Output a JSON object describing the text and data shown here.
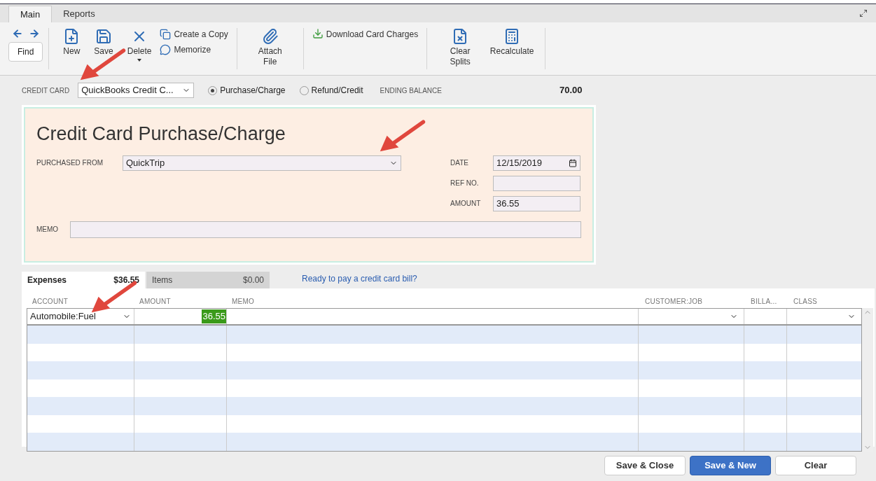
{
  "window_tabs": [
    {
      "label": "Main",
      "selected": true
    },
    {
      "label": "Reports",
      "selected": false
    }
  ],
  "toolbar": {
    "find": "Find",
    "groups": [
      [
        {
          "kind": "big",
          "label": "New"
        },
        {
          "kind": "big",
          "label": "Save"
        },
        {
          "kind": "dropdown",
          "label": "Delete"
        },
        {
          "kind": "stack",
          "items": [
            {
              "label": "Create a Copy"
            },
            {
              "label": "Memorize"
            }
          ]
        }
      ],
      [
        {
          "kind": "big",
          "label": "Attach File"
        }
      ],
      [
        {
          "kind": "inline",
          "label": "Download Card Charges"
        }
      ],
      [
        {
          "kind": "big",
          "label": "Clear Splits"
        },
        {
          "kind": "big",
          "label": "Recalculate"
        }
      ]
    ]
  },
  "account_bar": {
    "label": "CREDIT CARD",
    "account": "QuickBooks Credit C...",
    "modes": [
      {
        "label": "Purchase/Charge",
        "selected": true
      },
      {
        "label": "Refund/Credit",
        "selected": false
      }
    ],
    "balance_label": "ENDING BALANCE",
    "balance": "70.00"
  },
  "form": {
    "title": "Credit Card Purchase/Charge",
    "purchased_from_label": "PURCHASED FROM",
    "purchased_from": "QuickTrip",
    "date_label": "DATE",
    "date": "12/15/2019",
    "ref_label": "REF NO.",
    "amount_label": "AMOUNT",
    "amount": "36.55",
    "memo_label": "MEMO"
  },
  "detail_tabs": [
    {
      "label": "Expenses",
      "total": "$36.55",
      "selected": true
    },
    {
      "label": "Items",
      "total": "$0.00",
      "selected": false
    }
  ],
  "bill_link": "Ready to pay a credit card bill?",
  "table": {
    "columns": [
      "ACCOUNT",
      "AMOUNT",
      "MEMO",
      "CUSTOMER:JOB",
      "BILLA...",
      "CLASS"
    ],
    "rows": [
      {
        "account": "Automobile:Fuel",
        "amount": "36.55"
      }
    ]
  },
  "buttons": [
    {
      "label": "Save & Close",
      "primary": false
    },
    {
      "label": "Save & New",
      "primary": true
    },
    {
      "label": "Clear",
      "primary": false
    }
  ]
}
